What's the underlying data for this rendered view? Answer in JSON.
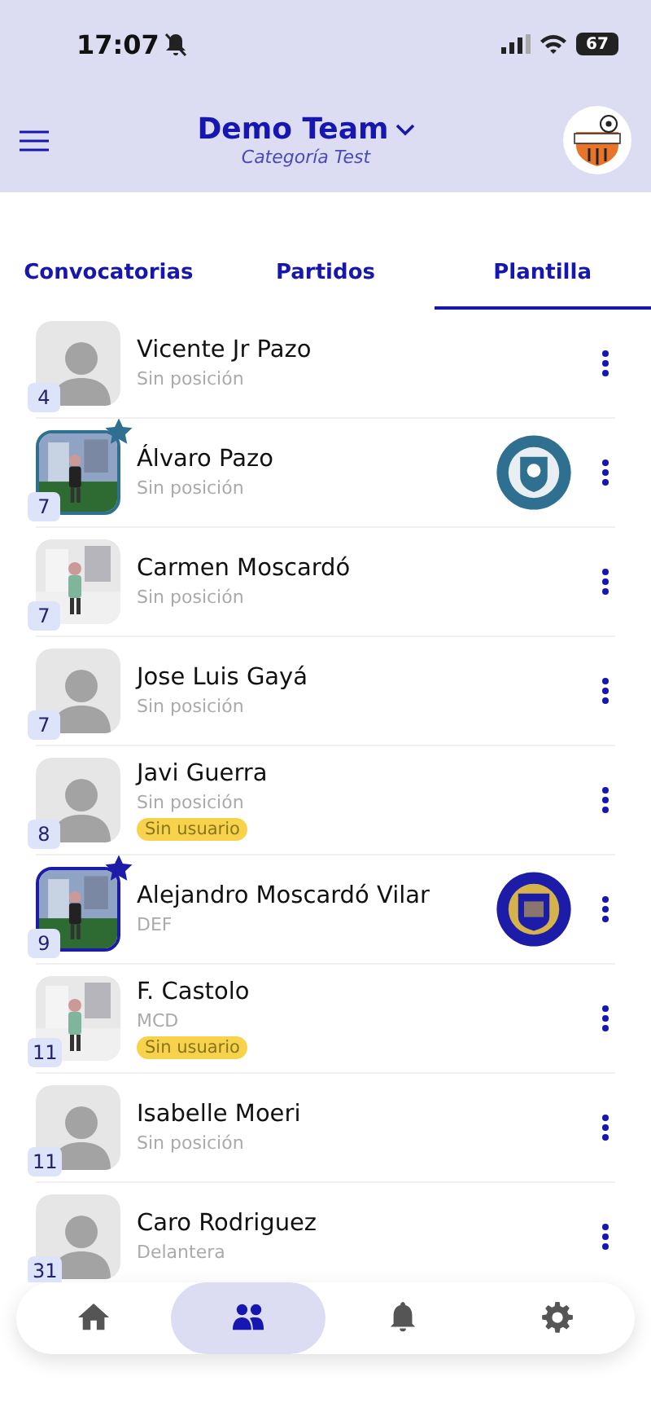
{
  "status_bar": {
    "time": "17:07",
    "battery": "67",
    "silent": true
  },
  "header": {
    "team": "Demo Team",
    "category": "Categoría Test"
  },
  "tabs": [
    {
      "label": "Convocatorias",
      "selected": false
    },
    {
      "label": "Partidos",
      "selected": false
    },
    {
      "label": "Plantilla",
      "selected": true
    }
  ],
  "players": [
    {
      "name": "Vicente Jr Pazo",
      "position": "Sin posición",
      "number": "4",
      "photo": false,
      "starred": false
    },
    {
      "name": "Álvaro Pazo",
      "position": "Sin posición",
      "number": "7",
      "photo": true,
      "starred": true,
      "color": "#2f6f8f",
      "emblem": {
        "kind": "shield"
      }
    },
    {
      "name": "Carmen Moscardó",
      "position": "Sin posición",
      "number": "7",
      "photo": true,
      "starred": false
    },
    {
      "name": "Jose Luis Gayá",
      "position": "Sin posición",
      "number": "7",
      "photo": false,
      "starred": false
    },
    {
      "name": "Javi Guerra",
      "position": "Sin posición",
      "number": "8",
      "photo": false,
      "starred": false,
      "tag": "Sin usuario"
    },
    {
      "name": "Alejandro Moscardó Vilar",
      "position": "DEF",
      "number": "9",
      "photo": true,
      "starred": true,
      "color": "#1c1ca8",
      "emblem": {
        "kind": "number"
      }
    },
    {
      "name": "F. Castolo",
      "position": "MCD",
      "number": "11",
      "photo": true,
      "starred": false,
      "tag": "Sin usuario"
    },
    {
      "name": "Isabelle Moeri",
      "position": "Sin posición",
      "number": "11",
      "photo": false,
      "starred": false
    },
    {
      "name": "Caro Rodriguez",
      "position": "Delantera",
      "number": "31",
      "photo": false,
      "starred": false
    }
  ],
  "nav": [
    {
      "kind": "home",
      "selected": false
    },
    {
      "kind": "team",
      "selected": true
    },
    {
      "kind": "bell",
      "selected": false
    },
    {
      "kind": "settings",
      "selected": false
    }
  ]
}
